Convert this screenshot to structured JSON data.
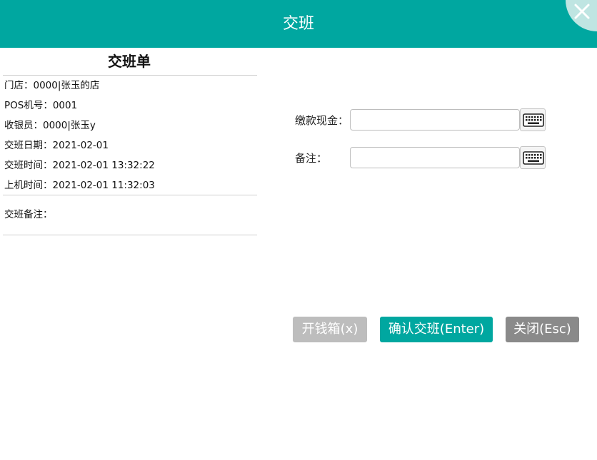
{
  "window": {
    "title": "交班"
  },
  "slip": {
    "title": "交班单",
    "rows": [
      "门店：0000|张玉的店",
      "POS机号：0001",
      "收银员：0000|张玉y",
      "交班日期：2021-02-01",
      "交班时间：2021-02-01 13:32:22",
      "上机时间：2021-02-01 11:32:03"
    ],
    "remark_label": "交班备注："
  },
  "form": {
    "cash_label": "缴款现金：",
    "cash_value": "",
    "remark_label": "备注：",
    "remark_value": ""
  },
  "buttons": {
    "drawer": "开钱箱(x)",
    "confirm": "确认交班(Enter)",
    "close": "关闭(Esc)"
  },
  "colors": {
    "accent": "#00a7a0",
    "close_corner": "#bfe5e2",
    "drawer_button": "#bdbdbd",
    "close_button": "#8a8a8a"
  }
}
